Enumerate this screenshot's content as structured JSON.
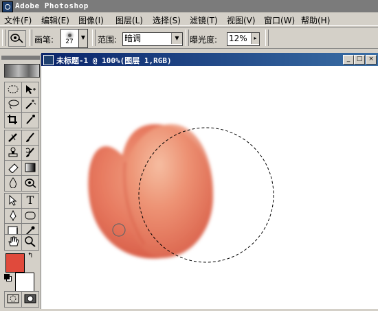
{
  "app": {
    "title": "Adobe Photoshop"
  },
  "menu": [
    {
      "label": "文件(F)"
    },
    {
      "label": "编辑(E)"
    },
    {
      "label": "图像(I)"
    },
    {
      "label": "图层(L)"
    },
    {
      "label": "选择(S)"
    },
    {
      "label": "滤镜(T)"
    },
    {
      "label": "视图(V)"
    },
    {
      "label": "窗口(W)"
    },
    {
      "label": "帮助(H)"
    }
  ],
  "options": {
    "brush_label": "画笔:",
    "brush_size": "27",
    "range_label": "范围:",
    "range_value": "暗调",
    "exposure_label": "曝光度:",
    "exposure_value": "12%"
  },
  "document": {
    "title": "未标题-1 @ 100%(图层 1,RGB)"
  },
  "colors": {
    "foreground": "#e04a3c",
    "background": "#ffffff",
    "peach": "#e8735a",
    "doc_titlebar": "#0a246a"
  },
  "icons": [
    "dodge-tool-icon",
    "marquee-icon",
    "move-icon",
    "lasso-icon",
    "magic-wand-icon",
    "crop-icon",
    "slice-icon",
    "healing-brush-icon",
    "brush-icon",
    "clone-stamp-icon",
    "history-brush-icon",
    "eraser-icon",
    "gradient-icon",
    "blur-icon",
    "dodge-icon",
    "path-select-icon",
    "type-icon",
    "pen-icon",
    "shape-icon",
    "notes-icon",
    "eyedropper-icon",
    "hand-icon",
    "zoom-icon",
    "standard-mode-icon",
    "quickmask-mode-icon"
  ]
}
